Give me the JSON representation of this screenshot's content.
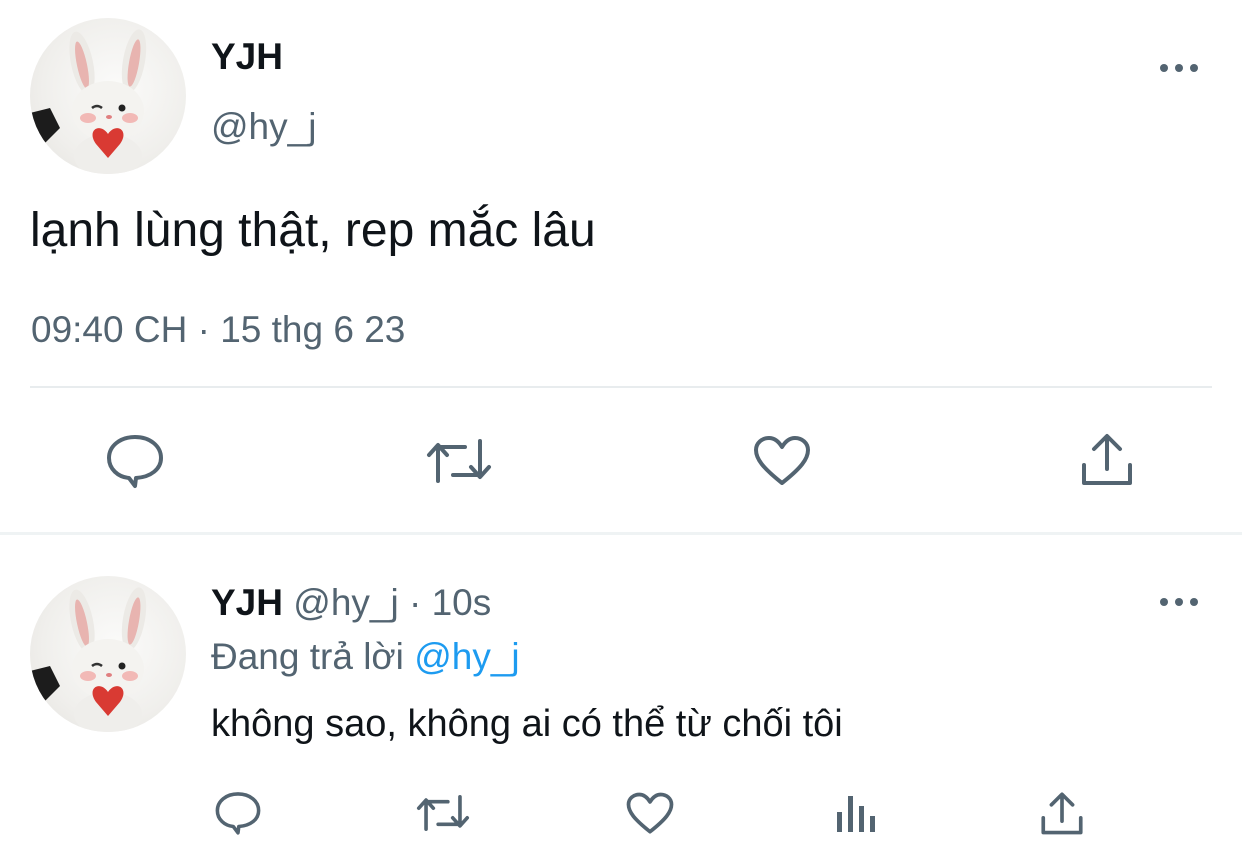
{
  "main_tweet": {
    "author_name": "YJH",
    "author_handle": "@hy_j",
    "text": "lạnh lùng thật, rep mắc lâu",
    "timestamp": "09:40 CH · 15 thg 6 23",
    "actions": [
      "reply-icon",
      "retweet-icon",
      "like-icon",
      "share-icon"
    ]
  },
  "reply_tweet": {
    "author_name": "YJH",
    "author_handle": "@hy_j",
    "separator": " · ",
    "time_ago": "10s",
    "replying_to_label": "Đang trả lời",
    "replying_to_handle": "@hy_j",
    "text": "không sao, không ai có thể từ chối tôi",
    "actions": [
      "reply-icon",
      "retweet-icon",
      "like-icon",
      "views-icon",
      "share-icon"
    ]
  },
  "colors": {
    "text": "#0f1419",
    "secondary": "#536471",
    "accent": "#1d9bf0",
    "divider": "#eff3f4"
  }
}
